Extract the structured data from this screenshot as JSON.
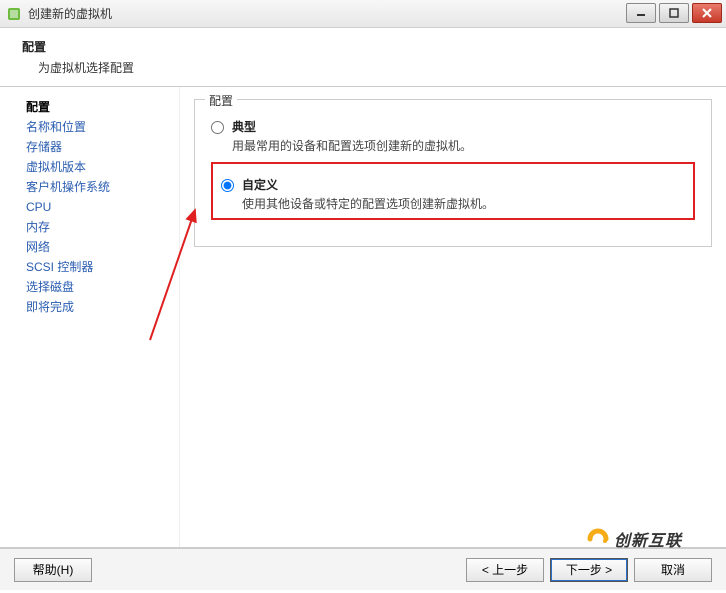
{
  "window": {
    "title": "创建新的虚拟机"
  },
  "header": {
    "title": "配置",
    "subtitle": "为虚拟机选择配置"
  },
  "sidebar": {
    "items": [
      {
        "label": "配置",
        "active": true
      },
      {
        "label": "名称和位置",
        "active": false
      },
      {
        "label": "存储器",
        "active": false
      },
      {
        "label": "虚拟机版本",
        "active": false
      },
      {
        "label": "客户机操作系统",
        "active": false
      },
      {
        "label": "CPU",
        "active": false
      },
      {
        "label": "内存",
        "active": false
      },
      {
        "label": "网络",
        "active": false
      },
      {
        "label": "SCSI 控制器",
        "active": false
      },
      {
        "label": "选择磁盘",
        "active": false
      },
      {
        "label": "即将完成",
        "active": false
      }
    ]
  },
  "content": {
    "group_legend": "配置",
    "options": [
      {
        "key": "typical",
        "label": "典型",
        "desc": "用最常用的设备和配置选项创建新的虚拟机。",
        "selected": false,
        "highlighted": false
      },
      {
        "key": "custom",
        "label": "自定义",
        "desc": "使用其他设备或特定的配置选项创建新虚拟机。",
        "selected": true,
        "highlighted": true
      }
    ]
  },
  "footer": {
    "help": "帮助(H)",
    "back": "< 上一步",
    "next": "下一步 >",
    "cancel": "取消"
  },
  "watermark": {
    "text": "创新互联"
  },
  "colors": {
    "highlight_box": "#e02020",
    "link": "#2a5db0",
    "close_btn": "#c83a2a"
  }
}
